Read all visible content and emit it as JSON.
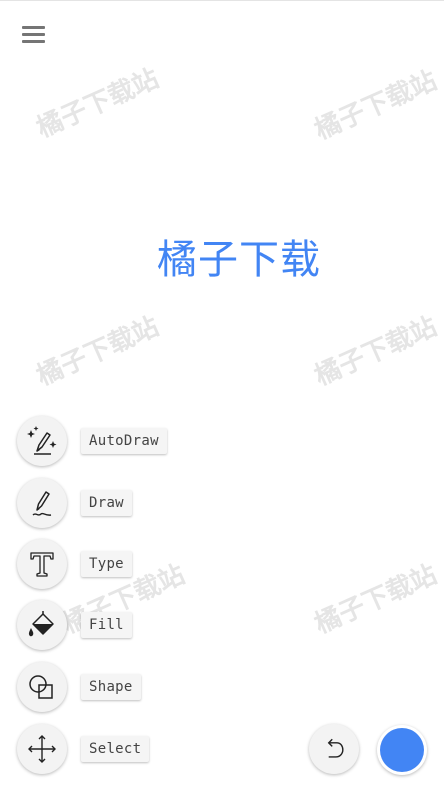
{
  "canvas": {
    "text": "橘子下载",
    "text_color": "#4285f4"
  },
  "watermark": {
    "text": "橘子下载站"
  },
  "menu": {
    "icon": "hamburger-menu-icon"
  },
  "tools": [
    {
      "id": "autodraw",
      "label": "AutoDraw",
      "icon": "autodraw-sparkle-pencil-icon"
    },
    {
      "id": "draw",
      "label": "Draw",
      "icon": "pencil-icon"
    },
    {
      "id": "type",
      "label": "Type",
      "icon": "text-t-icon"
    },
    {
      "id": "fill",
      "label": "Fill",
      "icon": "paint-bucket-icon"
    },
    {
      "id": "shape",
      "label": "Shape",
      "icon": "shapes-icon"
    },
    {
      "id": "select",
      "label": "Select",
      "icon": "move-arrows-icon"
    }
  ],
  "actions": {
    "undo_icon": "undo-icon",
    "current_color": "#4285f4"
  }
}
